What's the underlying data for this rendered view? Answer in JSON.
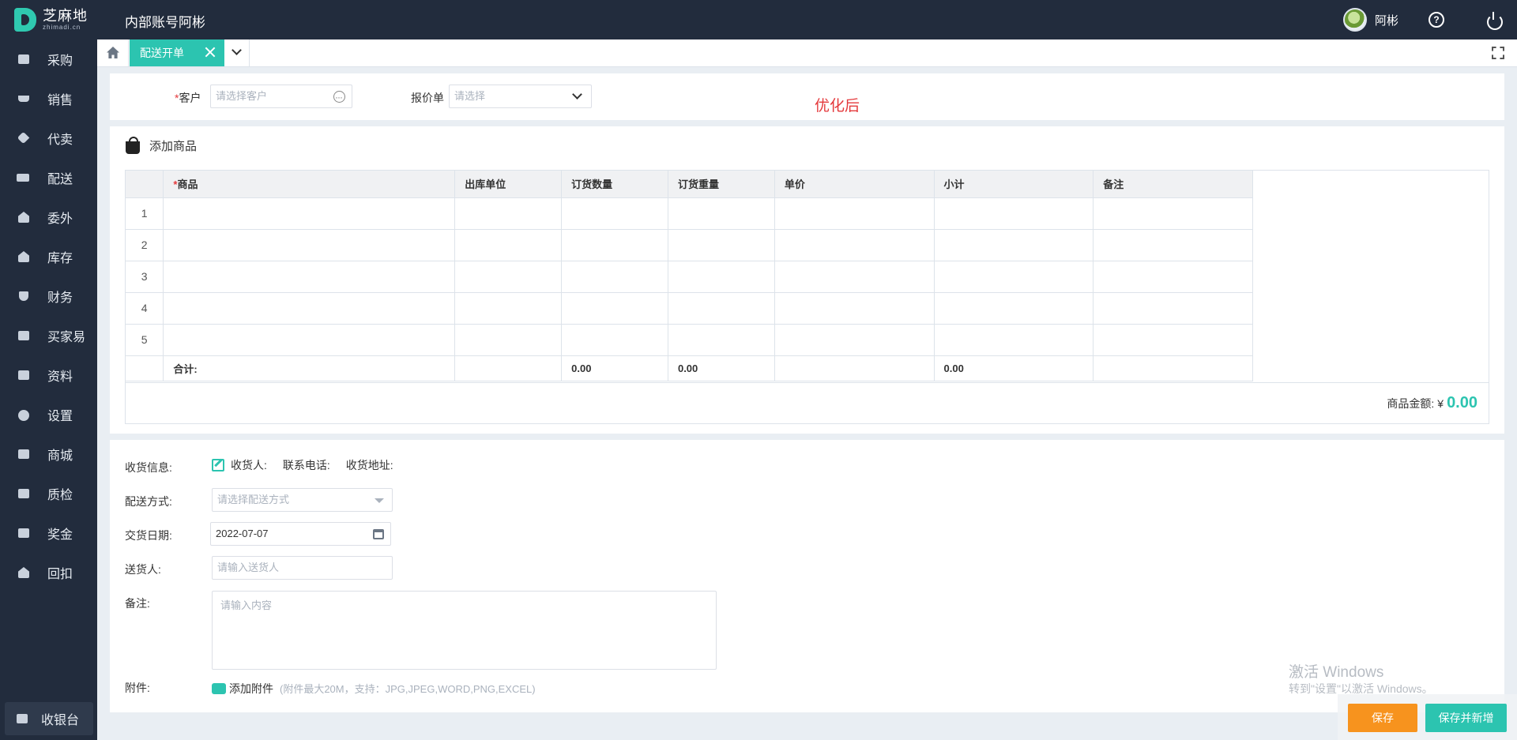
{
  "header": {
    "logo_cn": "芝麻地",
    "logo_en": "zhimadi.cn",
    "account_title": "内部账号阿彬",
    "username": "阿彬"
  },
  "sidebar": {
    "items": [
      {
        "label": "采购",
        "icon": "basket-icon"
      },
      {
        "label": "销售",
        "icon": "cart-icon"
      },
      {
        "label": "代卖",
        "icon": "tag-icon"
      },
      {
        "label": "配送",
        "icon": "truck-icon"
      },
      {
        "label": "委外",
        "icon": "building-icon"
      },
      {
        "label": "库存",
        "icon": "warehouse-icon"
      },
      {
        "label": "财务",
        "icon": "money-shield-icon"
      },
      {
        "label": "买家易",
        "icon": "store-icon"
      },
      {
        "label": "资料",
        "icon": "archive-icon"
      },
      {
        "label": "设置",
        "icon": "gear-icon"
      },
      {
        "label": "商城",
        "icon": "shop-icon"
      },
      {
        "label": "质检",
        "icon": "inspection-icon"
      },
      {
        "label": "奖金",
        "icon": "bonus-icon"
      },
      {
        "label": "回扣",
        "icon": "rebate-icon"
      }
    ],
    "cashier_label": "收银台"
  },
  "tabs": {
    "active_label": "配送开单"
  },
  "order": {
    "customer_label": "客户",
    "customer_placeholder": "请选择客户",
    "quote_label": "报价单",
    "quote_placeholder": "请选择",
    "note": "优化后"
  },
  "goods": {
    "section_title": "添加商品",
    "columns": [
      "商品",
      "出库单位",
      "订货数量",
      "订货重量",
      "单价",
      "小计",
      "备注"
    ],
    "row_numbers": [
      "1",
      "2",
      "3",
      "4",
      "5"
    ],
    "total_label": "合计:",
    "total_qty": "0.00",
    "total_weight": "0.00",
    "total_subtotal": "0.00",
    "amount_label": "商品金额:",
    "currency": "¥",
    "amount_value": "0.00"
  },
  "delivery": {
    "receive_label": "收货信息:",
    "receiver_label": "收货人:",
    "phone_label": "联系电话:",
    "address_label": "收货地址:",
    "method_label": "配送方式:",
    "method_placeholder": "请选择配送方式",
    "date_label": "交货日期:",
    "date_value": "2022-07-07",
    "deliverer_label": "送货人:",
    "deliverer_placeholder": "请输入送货人",
    "remark_label": "备注:",
    "remark_placeholder": "请输入内容",
    "attach_label": "附件:",
    "attach_button": "添加附件",
    "attach_hint": "(附件最大20M，支持：JPG,JPEG,WORD,PNG,EXCEL)"
  },
  "watermark": {
    "line1": "激活 Windows",
    "line2": "转到\"设置\"以激活 Windows。"
  },
  "actions": {
    "save": "保存",
    "save_new": "保存并新增"
  },
  "colors": {
    "accent": "#2cc4b0",
    "sidebar_bg": "#222c3d",
    "save_orange": "#f7931e",
    "required_red": "#e4393c"
  }
}
